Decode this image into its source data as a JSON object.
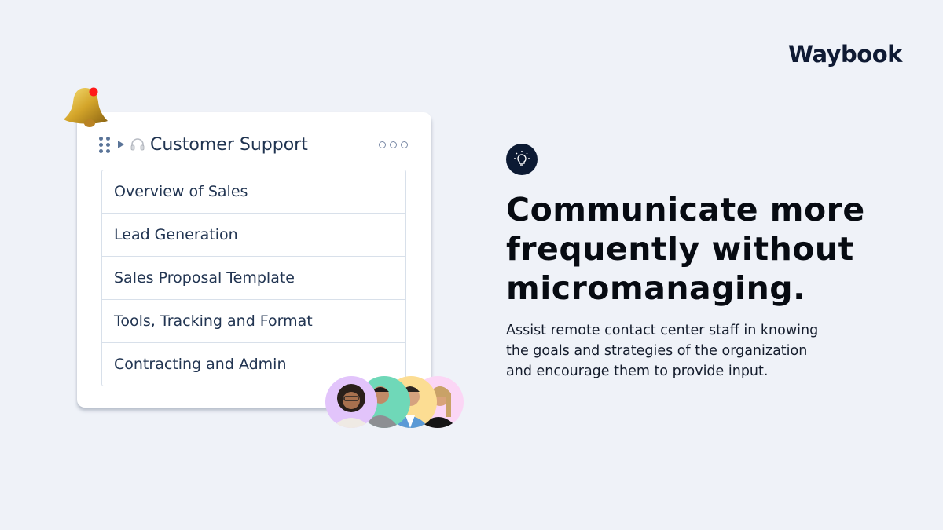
{
  "brand": {
    "logo_text": "Waybook"
  },
  "card": {
    "title": "Customer Support",
    "section_icon": "headphones-icon",
    "items": [
      {
        "label": "Overview of Sales"
      },
      {
        "label": "Lead Generation"
      },
      {
        "label": "Sales Proposal Template"
      },
      {
        "label": "Tools, Tracking and Format"
      },
      {
        "label": "Contracting and Admin"
      }
    ]
  },
  "notification": {
    "icon": "bell-icon",
    "badge_color": "#ff1a1a"
  },
  "avatars": [
    {
      "bg": "#e2c4fb"
    },
    {
      "bg": "#6fd8b8"
    },
    {
      "bg": "#fcdd93"
    },
    {
      "bg": "#fbd6f5"
    }
  ],
  "feature": {
    "icon": "lightbulb-icon",
    "headline_lines": [
      "Communicate more",
      "frequently without",
      "micromanaging."
    ],
    "description_lines": [
      "Assist remote contact center staff in knowing",
      "the goals and strategies of the organization",
      "and encourage them to provide input."
    ]
  }
}
